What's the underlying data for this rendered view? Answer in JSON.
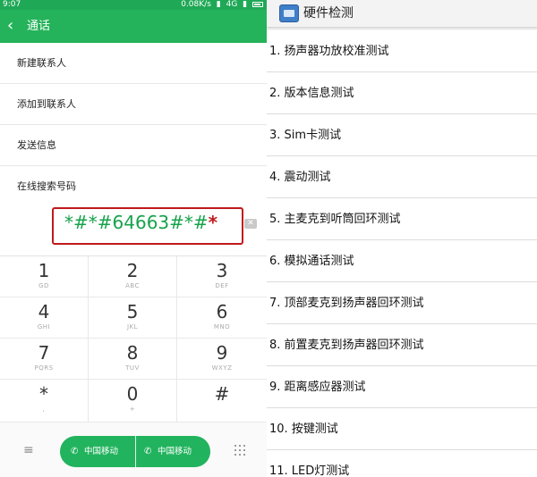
{
  "left_phone": {
    "status_bar": {
      "time": "9:07",
      "speed": "0.08K/s",
      "network": "4G",
      "battery_icon": "battery-icon"
    },
    "header": {
      "title": "通话",
      "back_icon": "chevron-left-icon"
    },
    "menu": [
      {
        "label": "新建联系人"
      },
      {
        "label": "添加到联系人"
      },
      {
        "label": "发送信息"
      },
      {
        "label": "在线搜索号码"
      }
    ],
    "dialed_number": "*#*#64663#*#",
    "dialed_number_last": "*",
    "keys": [
      {
        "digit": "1",
        "letters": "GD"
      },
      {
        "digit": "2",
        "letters": "ABC"
      },
      {
        "digit": "3",
        "letters": "DEF"
      },
      {
        "digit": "4",
        "letters": "GHI"
      },
      {
        "digit": "5",
        "letters": "JKL"
      },
      {
        "digit": "6",
        "letters": "MNO"
      },
      {
        "digit": "7",
        "letters": "PQRS"
      },
      {
        "digit": "8",
        "letters": "TUV"
      },
      {
        "digit": "9",
        "letters": "WXYZ"
      },
      {
        "digit": "*",
        "letters": ","
      },
      {
        "digit": "0",
        "letters": "+"
      },
      {
        "digit": "#",
        "letters": ""
      }
    ],
    "call_buttons": [
      {
        "label": "中国移动"
      },
      {
        "label": "中国移动"
      }
    ],
    "colors": {
      "accent_green": "#24b35a",
      "highlight_red": "#c0191c"
    }
  },
  "right_phone": {
    "title": "硬件检测",
    "tests": [
      "1. 扬声器功放校准测试",
      "2. 版本信息测试",
      "3. Sim卡测试",
      "4. 震动测试",
      "5. 主麦克到听筒回环测试",
      "6. 模拟通话测试",
      "7. 顶部麦克到扬声器回环测试",
      "8. 前置麦克到扬声器回环测试",
      "9. 距离感应器测试",
      "10. 按键测试",
      "11. LED灯测试"
    ]
  }
}
